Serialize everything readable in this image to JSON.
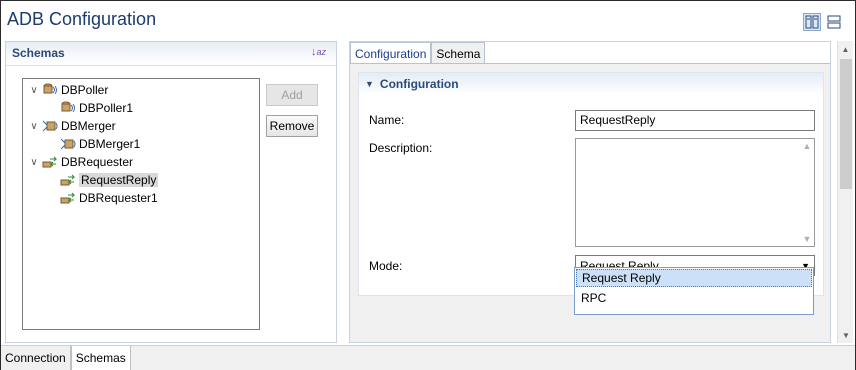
{
  "title": "ADB Configuration",
  "schemas_panel": {
    "header": "Schemas",
    "tree": [
      {
        "label": "DBPoller",
        "depth": 0,
        "icon": "db-poller-icon",
        "expanded": true
      },
      {
        "label": "DBPoller1",
        "depth": 1,
        "icon": "db-poller-icon"
      },
      {
        "label": "DBMerger",
        "depth": 0,
        "icon": "db-merger-icon",
        "expanded": true
      },
      {
        "label": "DBMerger1",
        "depth": 1,
        "icon": "db-merger-icon"
      },
      {
        "label": "DBRequester",
        "depth": 0,
        "icon": "db-requester-icon",
        "expanded": true
      },
      {
        "label": "RequestReply",
        "depth": 1,
        "icon": "db-requester-icon",
        "selected": true
      },
      {
        "label": "DBRequester1",
        "depth": 1,
        "icon": "db-requester-icon"
      }
    ],
    "add_label": "Add",
    "remove_label": "Remove"
  },
  "right_panel": {
    "tabs": [
      "Configuration",
      "Schema"
    ],
    "section_title": "Configuration",
    "name_label": "Name:",
    "name_value": "RequestReply",
    "description_label": "Description:",
    "description_value": "",
    "mode_label": "Mode:",
    "mode_value": "Request Reply",
    "mode_options": [
      "Request Reply",
      "RPC"
    ]
  },
  "bottom_tabs": [
    "Connection",
    "Schemas"
  ]
}
